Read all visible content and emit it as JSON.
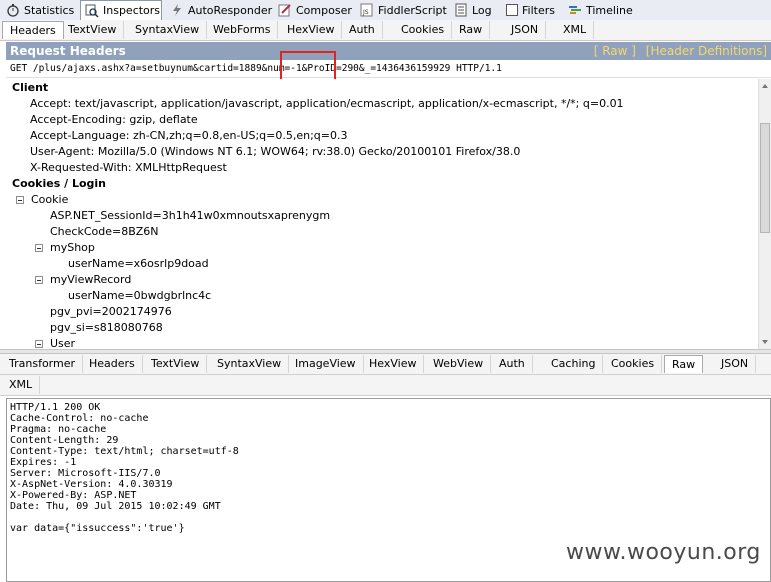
{
  "top_tabs": [
    {
      "label": "Statistics",
      "icon": "stopwatch-icon"
    },
    {
      "label": "Inspectors",
      "icon": "magnifier-icon"
    },
    {
      "label": "AutoResponder",
      "icon": "lightning-icon"
    },
    {
      "label": "Composer",
      "icon": "pencil-icon"
    },
    {
      "label": "FiddlerScript",
      "icon": "script-icon"
    },
    {
      "label": "Log",
      "icon": "log-icon"
    },
    {
      "label": "Filters",
      "icon": "checkbox-icon"
    },
    {
      "label": "Timeline",
      "icon": "timeline-icon"
    }
  ],
  "request_tabs": [
    "Headers",
    "TextView",
    "SyntaxView",
    "WebForms",
    "HexView",
    "Auth",
    "Cookies",
    "Raw",
    "JSON",
    "XML"
  ],
  "request_header": {
    "title": "Request Headers",
    "raw_link": "[ Raw ]",
    "defs_link": "[Header Definitions]",
    "request_line": "GET /plus/ajaxs.ashx?a=setbuynum&cartid=1889&num=-1&ProID=290&_=1436436159929 HTTP/1.1"
  },
  "tree": {
    "client_section": "Client",
    "client_headers": [
      "Accept: text/javascript, application/javascript, application/ecmascript, application/x-ecmascript, */*; q=0.01",
      "Accept-Encoding: gzip, deflate",
      "Accept-Language: zh-CN,zh;q=0.8,en-US;q=0.5,en;q=0.3",
      "User-Agent: Mozilla/5.0 (Windows NT 6.1; WOW64; rv:38.0) Gecko/20100101 Firefox/38.0",
      "X-Requested-With: XMLHttpRequest"
    ],
    "cookies_section": "Cookies / Login",
    "cookie_node": "Cookie",
    "session_id": "ASP.NET_SessionId=3h1h41w0xmnoutsxaprenygm",
    "check_code": "CheckCode=8BZ6N",
    "myshop_node": "myShop",
    "myshop_user": "userName=x6osrlp9doad",
    "myview_node": "myViewRecord",
    "myview_user": "userName=0bwdgbrlnc4c",
    "pgv_pvi": "pgv_pvi=2002174976",
    "pgv_si": "pgv_si=s818080768",
    "user_node": "User"
  },
  "response_tabs_row1": [
    "Transformer",
    "Headers",
    "TextView",
    "SyntaxView",
    "ImageView",
    "HexView",
    "WebView",
    "Auth",
    "Caching",
    "Cookies",
    "Raw",
    "JSON"
  ],
  "response_tabs_row2": [
    "XML"
  ],
  "response_raw": [
    "HTTP/1.1 200 OK",
    "Cache-Control: no-cache",
    "Pragma: no-cache",
    "Content-Length: 29",
    "Content-Type: text/html; charset=utf-8",
    "Expires: -1",
    "Server: Microsoft-IIS/7.0",
    "X-AspNet-Version: 4.0.30319",
    "X-Powered-By: ASP.NET",
    "Date: Thu, 09 Jul 2015 10:02:49 GMT",
    "",
    "var data={\"issuccess\":'true'}"
  ],
  "watermark": "www.wooyun.org",
  "colors": {
    "header_bar": "#8fa1bc",
    "link_yellow": "#f5d86b",
    "highlight_box": "#e0241f"
  }
}
